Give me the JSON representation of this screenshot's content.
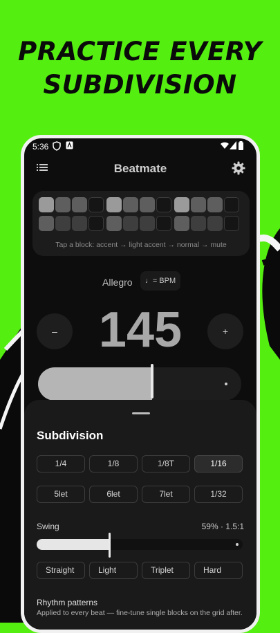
{
  "promo": {
    "headline_line1": "PRACTICE EVERY",
    "headline_line2": "SUBDIVISION"
  },
  "status_bar": {
    "time": "5:36"
  },
  "app_bar": {
    "title": "Beatmate"
  },
  "beat_grid": {
    "rows": [
      [
        "accent",
        "light",
        "light",
        "mute",
        "accent",
        "light",
        "light",
        "mute",
        "accent",
        "light",
        "light",
        "mute"
      ],
      [
        "light",
        "normal",
        "normal",
        "mute",
        "light",
        "normal",
        "normal",
        "mute",
        "light",
        "normal",
        "normal",
        "mute"
      ]
    ],
    "hint": "Tap a block: accent → light accent → normal → mute"
  },
  "tempo": {
    "name": "Allegro",
    "chip_label": "♩= BPM",
    "minus_label": "–",
    "plus_label": "+",
    "bpm": "145",
    "slider_level": 0.56
  },
  "subdivision": {
    "title": "Subdivision",
    "row1": [
      {
        "label": "1/4",
        "selected": false
      },
      {
        "label": "1/8",
        "selected": false
      },
      {
        "label": "1/8T",
        "selected": false
      },
      {
        "label": "1/16",
        "selected": true
      }
    ],
    "row2": [
      {
        "label": "5let",
        "selected": false
      },
      {
        "label": "6let",
        "selected": false
      },
      {
        "label": "7let",
        "selected": false
      },
      {
        "label": "1/32",
        "selected": false
      }
    ]
  },
  "swing": {
    "label": "Swing",
    "value": "59% · 1.5:1",
    "level": 0.59,
    "presets": [
      "Straight",
      "Light",
      "Triplet",
      "Hard"
    ]
  },
  "rhythm_patterns": {
    "title": "Rhythm patterns",
    "subtitle": "Applied to every beat — fine-tune single blocks on the grid after."
  },
  "colors": {
    "background": "#55ee11",
    "phone_bg": "#0d0d0d",
    "sheet_bg": "#1a1a1a"
  }
}
